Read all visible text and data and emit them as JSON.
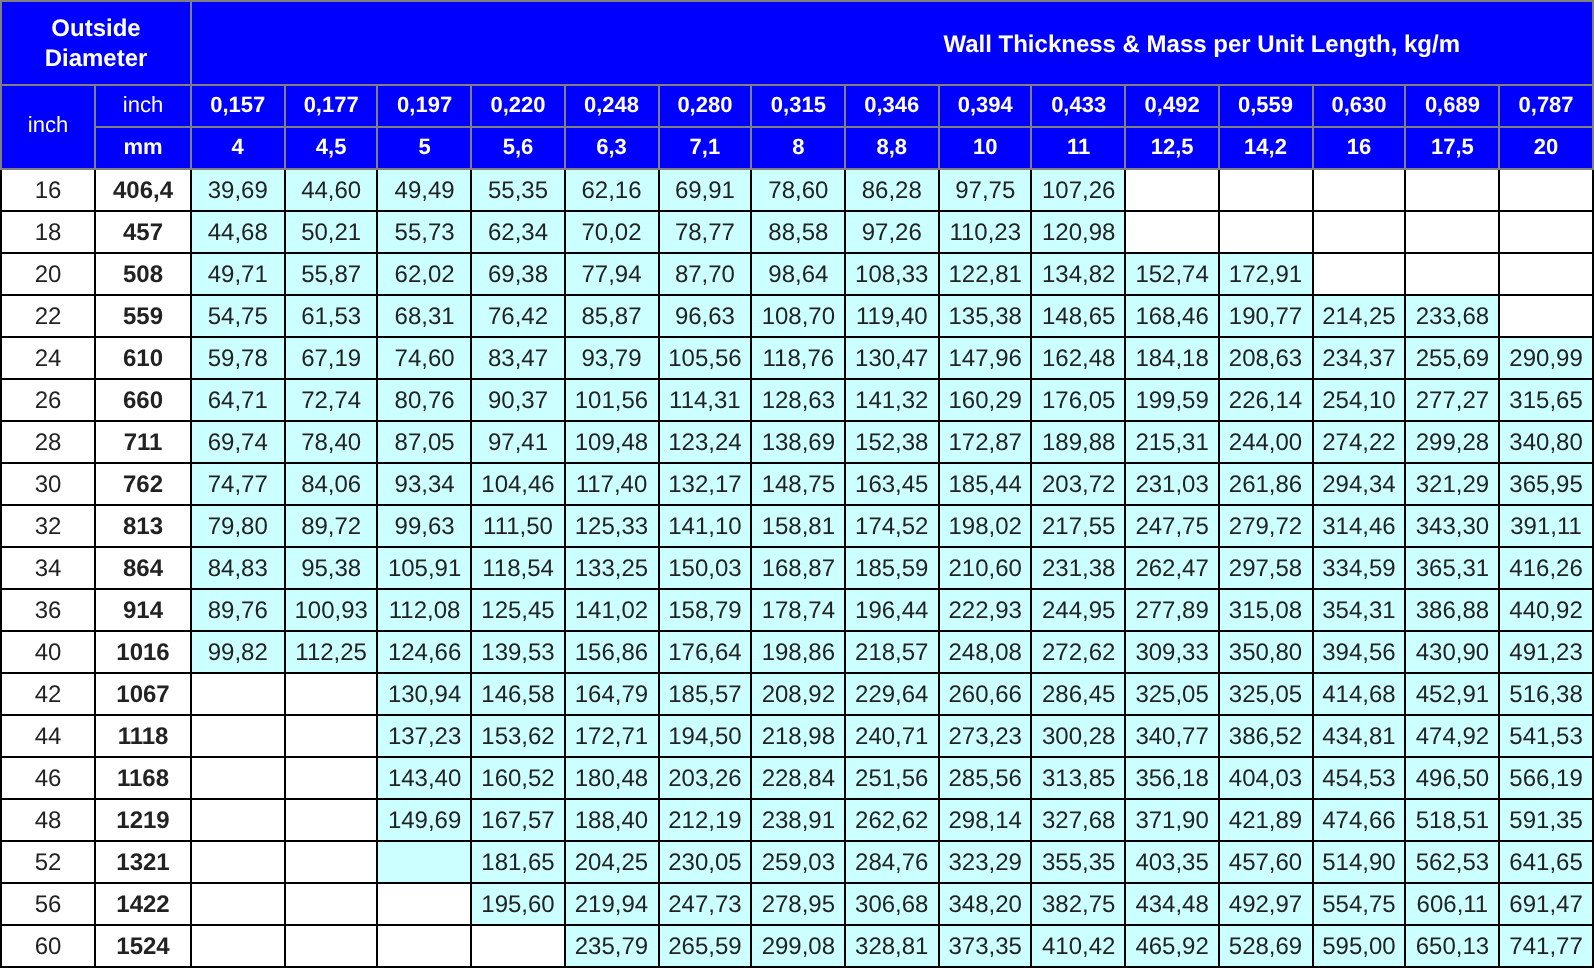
{
  "header": {
    "outside_diameter": "Outside Diameter",
    "title": "Wall Thickness & Mass per Unit Length, kg/m",
    "inch_label": "inch",
    "inch_unit": "inch",
    "mm_unit": "mm"
  },
  "thickness_inch": [
    "0,157",
    "0,177",
    "0,197",
    "0,220",
    "0,248",
    "0,280",
    "0,315",
    "0,346",
    "0,394",
    "0,433",
    "0,492",
    "0,559",
    "0,630",
    "0,689",
    "0,787"
  ],
  "thickness_mm": [
    "4",
    "4,5",
    "5",
    "5,6",
    "6,3",
    "7,1",
    "8",
    "8,8",
    "10",
    "11",
    "12,5",
    "14,2",
    "16",
    "17,5",
    "20"
  ],
  "rows": [
    {
      "inch": "16",
      "mm": "406,4",
      "cells": [
        "39,69",
        "44,60",
        "49,49",
        "55,35",
        "62,16",
        "69,91",
        "78,60",
        "86,28",
        "97,75",
        "107,26",
        null,
        null,
        null,
        null,
        null
      ]
    },
    {
      "inch": "18",
      "mm": "457",
      "cells": [
        "44,68",
        "50,21",
        "55,73",
        "62,34",
        "70,02",
        "78,77",
        "88,58",
        "97,26",
        "110,23",
        "120,98",
        null,
        null,
        null,
        null,
        null
      ]
    },
    {
      "inch": "20",
      "mm": "508",
      "cells": [
        "49,71",
        "55,87",
        "62,02",
        "69,38",
        "77,94",
        "87,70",
        "98,64",
        "108,33",
        "122,81",
        "134,82",
        "152,74",
        "172,91",
        null,
        null,
        null
      ]
    },
    {
      "inch": "22",
      "mm": "559",
      "cells": [
        "54,75",
        "61,53",
        "68,31",
        "76,42",
        "85,87",
        "96,63",
        "108,70",
        "119,40",
        "135,38",
        "148,65",
        "168,46",
        "190,77",
        "214,25",
        "233,68",
        null
      ]
    },
    {
      "inch": "24",
      "mm": "610",
      "cells": [
        "59,78",
        "67,19",
        "74,60",
        "83,47",
        "93,79",
        "105,56",
        "118,76",
        "130,47",
        "147,96",
        "162,48",
        "184,18",
        "208,63",
        "234,37",
        "255,69",
        "290,99"
      ]
    },
    {
      "inch": "26",
      "mm": "660",
      "cells": [
        "64,71",
        "72,74",
        "80,76",
        "90,37",
        "101,56",
        "114,31",
        "128,63",
        "141,32",
        "160,29",
        "176,05",
        "199,59",
        "226,14",
        "254,10",
        "277,27",
        "315,65"
      ]
    },
    {
      "inch": "28",
      "mm": "711",
      "cells": [
        "69,74",
        "78,40",
        "87,05",
        "97,41",
        "109,48",
        "123,24",
        "138,69",
        "152,38",
        "172,87",
        "189,88",
        "215,31",
        "244,00",
        "274,22",
        "299,28",
        "340,80"
      ]
    },
    {
      "inch": "30",
      "mm": "762",
      "cells": [
        "74,77",
        "84,06",
        "93,34",
        "104,46",
        "117,40",
        "132,17",
        "148,75",
        "163,45",
        "185,44",
        "203,72",
        "231,03",
        "261,86",
        "294,34",
        "321,29",
        "365,95"
      ]
    },
    {
      "inch": "32",
      "mm": "813",
      "cells": [
        "79,80",
        "89,72",
        "99,63",
        "111,50",
        "125,33",
        "141,10",
        "158,81",
        "174,52",
        "198,02",
        "217,55",
        "247,75",
        "279,72",
        "314,46",
        "343,30",
        "391,11"
      ]
    },
    {
      "inch": "34",
      "mm": "864",
      "cells": [
        "84,83",
        "95,38",
        "105,91",
        "118,54",
        "133,25",
        "150,03",
        "168,87",
        "185,59",
        "210,60",
        "231,38",
        "262,47",
        "297,58",
        "334,59",
        "365,31",
        "416,26"
      ]
    },
    {
      "inch": "36",
      "mm": "914",
      "cells": [
        "89,76",
        "100,93",
        "112,08",
        "125,45",
        "141,02",
        "158,79",
        "178,74",
        "196,44",
        "222,93",
        "244,95",
        "277,89",
        "315,08",
        "354,31",
        "386,88",
        "440,92"
      ]
    },
    {
      "inch": "40",
      "mm": "1016",
      "cells": [
        "99,82",
        "112,25",
        "124,66",
        "139,53",
        "156,86",
        "176,64",
        "198,86",
        "218,57",
        "248,08",
        "272,62",
        "309,33",
        "350,80",
        "394,56",
        "430,90",
        "491,23"
      ]
    },
    {
      "inch": "42",
      "mm": "1067",
      "cells": [
        null,
        null,
        "130,94",
        "146,58",
        "164,79",
        "185,57",
        "208,92",
        "229,64",
        "260,66",
        "286,45",
        "325,05",
        "325,05",
        "414,68",
        "452,91",
        "516,38"
      ]
    },
    {
      "inch": "44",
      "mm": "1118",
      "cells": [
        null,
        null,
        "137,23",
        "153,62",
        "172,71",
        "194,50",
        "218,98",
        "240,71",
        "273,23",
        "300,28",
        "340,77",
        "386,52",
        "434,81",
        "474,92",
        "541,53"
      ]
    },
    {
      "inch": "46",
      "mm": "1168",
      "cells": [
        null,
        null,
        "143,40",
        "160,52",
        "180,48",
        "203,26",
        "228,84",
        "251,56",
        "285,56",
        "313,85",
        "356,18",
        "404,03",
        "454,53",
        "496,50",
        "566,19"
      ]
    },
    {
      "inch": "48",
      "mm": "1219",
      "cells": [
        null,
        null,
        "149,69",
        "167,57",
        "188,40",
        "212,19",
        "238,91",
        "262,62",
        "298,14",
        "327,68",
        "371,90",
        "421,89",
        "474,66",
        "518,51",
        "591,35"
      ]
    },
    {
      "inch": "52",
      "mm": "1321",
      "cells": [
        null,
        null,
        {
          "shaded": true
        },
        "181,65",
        "204,25",
        "230,05",
        "259,03",
        "284,76",
        "323,29",
        "355,35",
        "403,35",
        "457,60",
        "514,90",
        "562,53",
        "641,65"
      ]
    },
    {
      "inch": "56",
      "mm": "1422",
      "cells": [
        null,
        null,
        null,
        "195,60",
        "219,94",
        "247,73",
        "278,95",
        "306,68",
        "348,20",
        "382,75",
        "434,48",
        "492,97",
        "554,75",
        "606,11",
        "691,47"
      ]
    },
    {
      "inch": "60",
      "mm": "1524",
      "cells": [
        null,
        null,
        null,
        null,
        "235,79",
        "265,59",
        "299,08",
        "328,81",
        "373,35",
        "410,42",
        "465,92",
        "528,69",
        "595,00",
        "650,13",
        "741,77"
      ]
    }
  ]
}
